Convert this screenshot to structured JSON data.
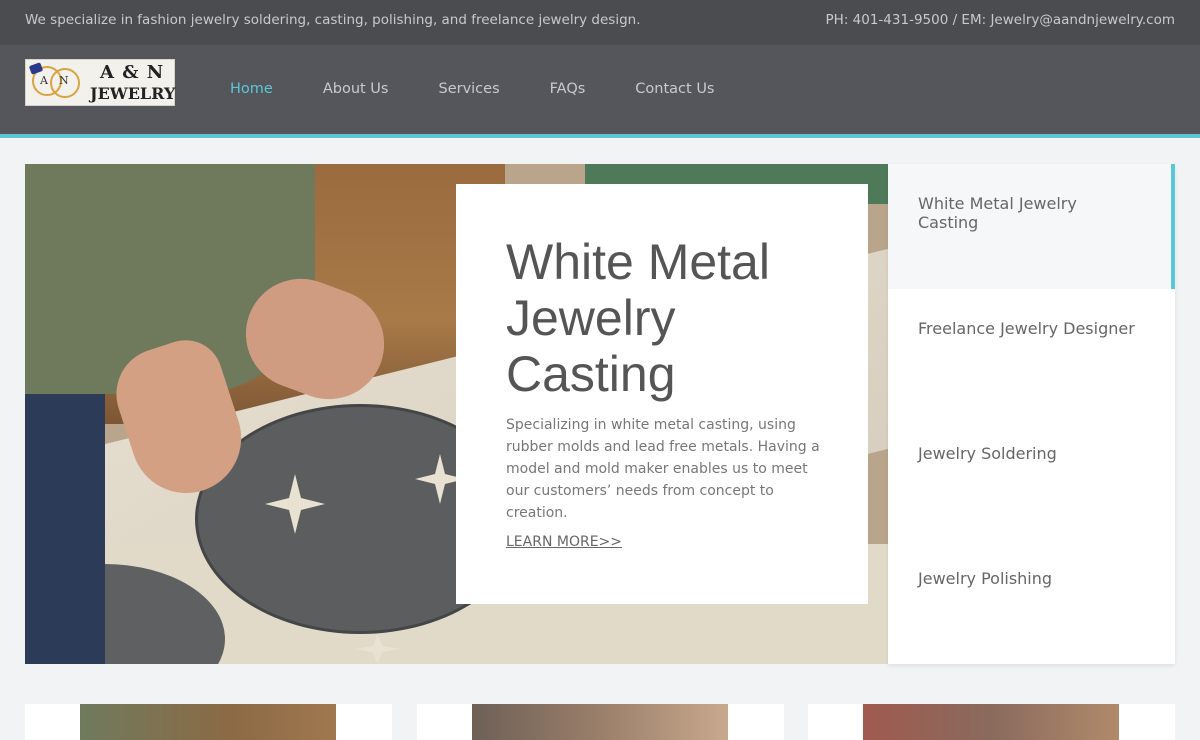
{
  "topbar": {
    "tagline": "We specialize in fashion jewelry soldering, casting, polishing, and freelance jewelry design.",
    "contact": "PH: 401-431-9500 / EM: Jewelry@aandnjewelry.com"
  },
  "logo": {
    "line1": "A & N",
    "line2": "JEWELRY",
    "monogram_a": "A",
    "monogram_n": "N"
  },
  "nav": {
    "items": [
      {
        "label": "Home",
        "active": true
      },
      {
        "label": "About Us"
      },
      {
        "label": "Services"
      },
      {
        "label": "FAQs"
      },
      {
        "label": "Contact Us"
      }
    ]
  },
  "hero": {
    "title": "White Metal Jewelry Casting",
    "description": "Specializing in white metal casting, using rubber molds and lead free metals. Having a model and mold maker enables us to meet our customers’ needs from concept to creation.",
    "link": "LEARN MORE>>"
  },
  "services": {
    "items": [
      {
        "label": "White Metal Jewelry Casting",
        "active": true
      },
      {
        "label": "Freelance Jewelry Designer"
      },
      {
        "label": "Jewelry Soldering"
      },
      {
        "label": "Jewelry Polishing"
      }
    ]
  },
  "colors": {
    "accent": "#5bc7d6",
    "topbar": "#4a4c50",
    "header": "#54565b"
  }
}
